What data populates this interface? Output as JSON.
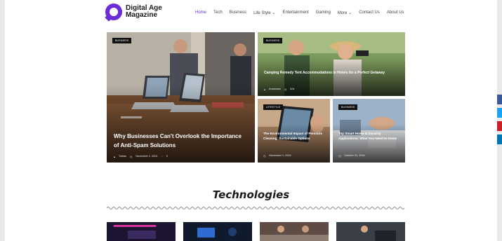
{
  "brand": {
    "line1": "Digital Age",
    "line2": "Magazine",
    "accent": "#6a2bd9"
  },
  "nav": {
    "items": [
      "Home",
      "Tech",
      "Business",
      "Life Style ⌄",
      "Entertainment",
      "Gaming",
      "More ⌄",
      "Contact Us",
      "About Us"
    ],
    "active_index": 0
  },
  "featured": [
    {
      "badge": "BUSINESS",
      "title": "Why Businesses Can't Overlook the Importance of Anti-Spam Solutions",
      "author": "Tobias",
      "date": "November 1, 2024",
      "comments": "0"
    },
    {
      "badge": "BUSINESS",
      "title": "Camping Remedy Tent Accommodations in Hotels for a Perfect Getaway",
      "author": "Anastasia",
      "date": "N/A"
    },
    {
      "badge": "LIFESTYLE",
      "title": "The Environmental Impact of Pressure Cleaning: Sustainable Options",
      "date": "November 1, 2024"
    },
    {
      "badge": "BUSINESS",
      "title": "Top Smart Home & Security Applications: What You Need to Know",
      "date": "October 31, 2024"
    }
  ],
  "section": {
    "title": "Technologies"
  },
  "social": [
    {
      "name": "facebook",
      "color": "#3b5998"
    },
    {
      "name": "twitter",
      "color": "#1da1f2"
    },
    {
      "name": "pinterest",
      "color": "#cb2027"
    },
    {
      "name": "linkedin",
      "color": "#0077b5"
    }
  ]
}
